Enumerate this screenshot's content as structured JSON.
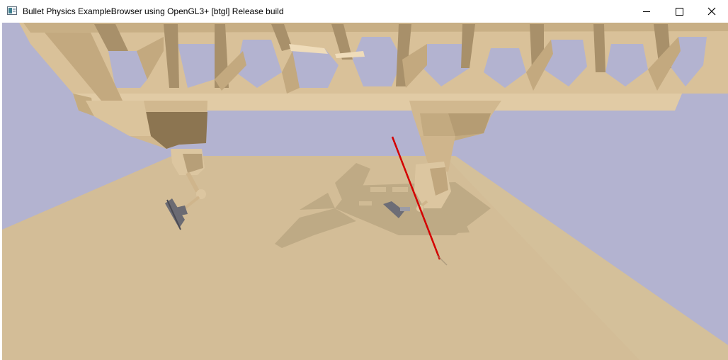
{
  "window": {
    "title": "Bullet Physics ExampleBrowser using OpenGL3+ [btgl] Release build",
    "icon": "app-icon"
  },
  "controls": {
    "minimize": "minimize-icon",
    "maximize": "maximize-icon",
    "close": "close-icon"
  },
  "scene": {
    "sky_color": "#b3b3d0",
    "ground_color": "#d3bd97",
    "structure_color": "#d9c199",
    "shadow_color": "#a69470",
    "laser_color": "#d40000"
  }
}
